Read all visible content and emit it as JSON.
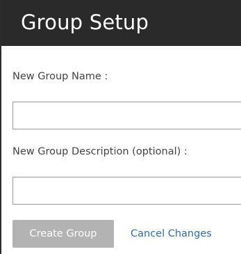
{
  "header": {
    "title": "Group Setup"
  },
  "form": {
    "name_label": "New Group Name :",
    "name_value": "",
    "description_label": "New Group Description (optional) :",
    "description_value": "",
    "create_button_label": "Create Group",
    "create_button_state": "disabled",
    "cancel_link_label": "Cancel Changes"
  },
  "colors": {
    "header_background": "#2a2a2a",
    "header_text": "#ffffff",
    "button_disabled_background": "#b3b3b3",
    "link": "#2a6fb5",
    "label_text": "#444444"
  }
}
